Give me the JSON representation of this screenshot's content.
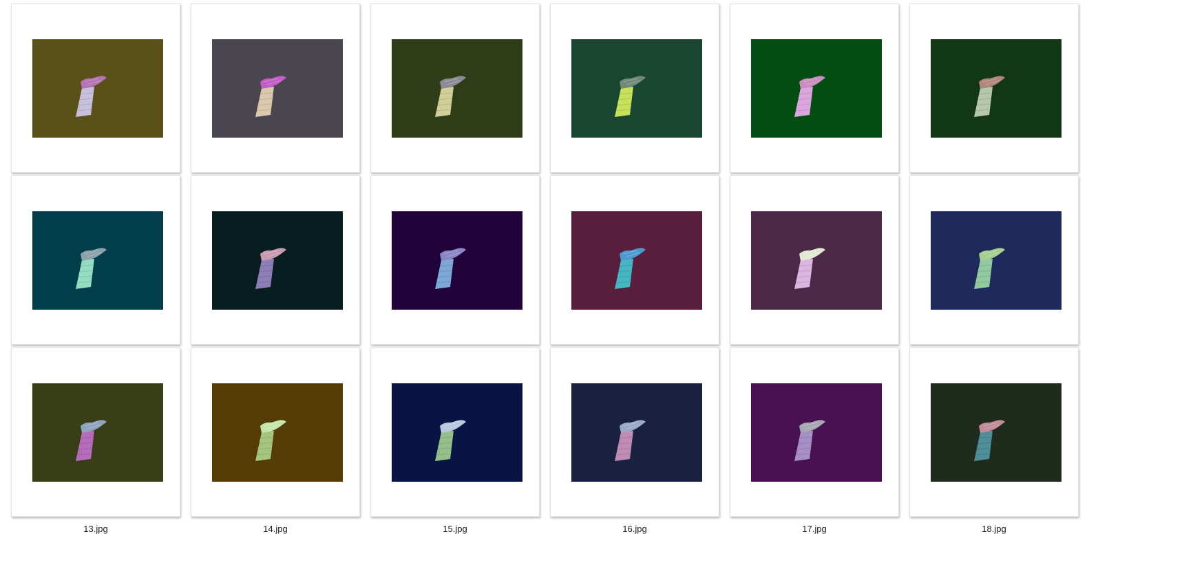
{
  "gallery": {
    "items": [
      {
        "filename": "1.jpg",
        "background": "#5a5118",
        "head_color": "#b673b4",
        "body_color": "#c7c0dc"
      },
      {
        "filename": "2.jpg",
        "background": "#4a4650",
        "head_color": "#c45dc7",
        "body_color": "#dbc9ad"
      },
      {
        "filename": "3.jpg",
        "background": "#2e3d18",
        "head_color": "#8d8a95",
        "body_color": "#d1cf98"
      },
      {
        "filename": "4.jpg",
        "background": "#1a4631",
        "head_color": "#72887a",
        "body_color": "#c9e05a"
      },
      {
        "filename": "5.jpg",
        "background": "#034d13",
        "head_color": "#c88ec0",
        "body_color": "#dba6de"
      },
      {
        "filename": "6.jpg",
        "background": "#113714",
        "head_color": "#b1877a",
        "body_color": "#b7c7ac"
      },
      {
        "filename": "7.jpg",
        "background": "#013d4b",
        "head_color": "#8ca1ac",
        "body_color": "#93dcc0"
      },
      {
        "filename": "8.jpg",
        "background": "#071d20",
        "head_color": "#c89bb0",
        "body_color": "#8c7eb6"
      },
      {
        "filename": "9.jpg",
        "background": "#21033a",
        "head_color": "#8a86c6",
        "body_color": "#7ca7d6"
      },
      {
        "filename": "10.jpg",
        "background": "#581e3c",
        "head_color": "#4d9ad1",
        "body_color": "#46b6c2"
      },
      {
        "filename": "11.jpg",
        "background": "#4b2748",
        "head_color": "#e2e8d2",
        "body_color": "#dcb6e0"
      },
      {
        "filename": "12.jpg",
        "background": "#1e2a5c",
        "head_color": "#a6cf8e",
        "body_color": "#91c9a0"
      },
      {
        "filename": "13.jpg",
        "background": "#383e18",
        "head_color": "#8fa3c1",
        "body_color": "#b66bbb"
      },
      {
        "filename": "14.jpg",
        "background": "#543c04",
        "head_color": "#c4e6ab",
        "body_color": "#a6c67f"
      },
      {
        "filename": "15.jpg",
        "background": "#081443",
        "head_color": "#b8c9dd",
        "body_color": "#94bf8a"
      },
      {
        "filename": "16.jpg",
        "background": "#1a2140",
        "head_color": "#9aa9c5",
        "body_color": "#c08bb4"
      },
      {
        "filename": "17.jpg",
        "background": "#481252",
        "head_color": "#a6a7b0",
        "body_color": "#a68fc5"
      },
      {
        "filename": "18.jpg",
        "background": "#1f2b1c",
        "head_color": "#c28b98",
        "body_color": "#4f8d99"
      }
    ]
  }
}
